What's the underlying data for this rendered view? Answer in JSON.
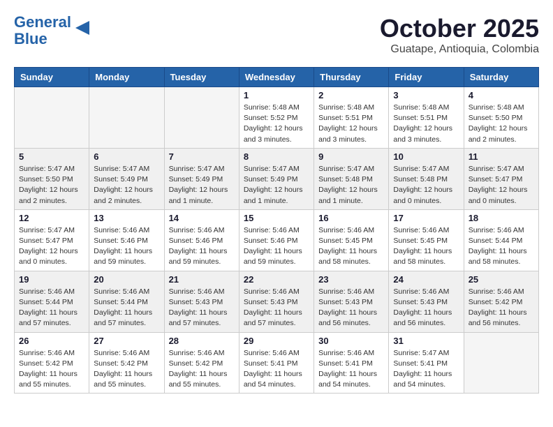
{
  "header": {
    "logo_line1": "General",
    "logo_line2": "Blue",
    "month": "October 2025",
    "location": "Guatape, Antioquia, Colombia"
  },
  "weekdays": [
    "Sunday",
    "Monday",
    "Tuesday",
    "Wednesday",
    "Thursday",
    "Friday",
    "Saturday"
  ],
  "weeks": [
    [
      {
        "day": "",
        "info": ""
      },
      {
        "day": "",
        "info": ""
      },
      {
        "day": "",
        "info": ""
      },
      {
        "day": "1",
        "info": "Sunrise: 5:48 AM\nSunset: 5:52 PM\nDaylight: 12 hours\nand 3 minutes."
      },
      {
        "day": "2",
        "info": "Sunrise: 5:48 AM\nSunset: 5:51 PM\nDaylight: 12 hours\nand 3 minutes."
      },
      {
        "day": "3",
        "info": "Sunrise: 5:48 AM\nSunset: 5:51 PM\nDaylight: 12 hours\nand 3 minutes."
      },
      {
        "day": "4",
        "info": "Sunrise: 5:48 AM\nSunset: 5:50 PM\nDaylight: 12 hours\nand 2 minutes."
      }
    ],
    [
      {
        "day": "5",
        "info": "Sunrise: 5:47 AM\nSunset: 5:50 PM\nDaylight: 12 hours\nand 2 minutes."
      },
      {
        "day": "6",
        "info": "Sunrise: 5:47 AM\nSunset: 5:49 PM\nDaylight: 12 hours\nand 2 minutes."
      },
      {
        "day": "7",
        "info": "Sunrise: 5:47 AM\nSunset: 5:49 PM\nDaylight: 12 hours\nand 1 minute."
      },
      {
        "day": "8",
        "info": "Sunrise: 5:47 AM\nSunset: 5:49 PM\nDaylight: 12 hours\nand 1 minute."
      },
      {
        "day": "9",
        "info": "Sunrise: 5:47 AM\nSunset: 5:48 PM\nDaylight: 12 hours\nand 1 minute."
      },
      {
        "day": "10",
        "info": "Sunrise: 5:47 AM\nSunset: 5:48 PM\nDaylight: 12 hours\nand 0 minutes."
      },
      {
        "day": "11",
        "info": "Sunrise: 5:47 AM\nSunset: 5:47 PM\nDaylight: 12 hours\nand 0 minutes."
      }
    ],
    [
      {
        "day": "12",
        "info": "Sunrise: 5:47 AM\nSunset: 5:47 PM\nDaylight: 12 hours\nand 0 minutes."
      },
      {
        "day": "13",
        "info": "Sunrise: 5:46 AM\nSunset: 5:46 PM\nDaylight: 11 hours\nand 59 minutes."
      },
      {
        "day": "14",
        "info": "Sunrise: 5:46 AM\nSunset: 5:46 PM\nDaylight: 11 hours\nand 59 minutes."
      },
      {
        "day": "15",
        "info": "Sunrise: 5:46 AM\nSunset: 5:46 PM\nDaylight: 11 hours\nand 59 minutes."
      },
      {
        "day": "16",
        "info": "Sunrise: 5:46 AM\nSunset: 5:45 PM\nDaylight: 11 hours\nand 58 minutes."
      },
      {
        "day": "17",
        "info": "Sunrise: 5:46 AM\nSunset: 5:45 PM\nDaylight: 11 hours\nand 58 minutes."
      },
      {
        "day": "18",
        "info": "Sunrise: 5:46 AM\nSunset: 5:44 PM\nDaylight: 11 hours\nand 58 minutes."
      }
    ],
    [
      {
        "day": "19",
        "info": "Sunrise: 5:46 AM\nSunset: 5:44 PM\nDaylight: 11 hours\nand 57 minutes."
      },
      {
        "day": "20",
        "info": "Sunrise: 5:46 AM\nSunset: 5:44 PM\nDaylight: 11 hours\nand 57 minutes."
      },
      {
        "day": "21",
        "info": "Sunrise: 5:46 AM\nSunset: 5:43 PM\nDaylight: 11 hours\nand 57 minutes."
      },
      {
        "day": "22",
        "info": "Sunrise: 5:46 AM\nSunset: 5:43 PM\nDaylight: 11 hours\nand 57 minutes."
      },
      {
        "day": "23",
        "info": "Sunrise: 5:46 AM\nSunset: 5:43 PM\nDaylight: 11 hours\nand 56 minutes."
      },
      {
        "day": "24",
        "info": "Sunrise: 5:46 AM\nSunset: 5:43 PM\nDaylight: 11 hours\nand 56 minutes."
      },
      {
        "day": "25",
        "info": "Sunrise: 5:46 AM\nSunset: 5:42 PM\nDaylight: 11 hours\nand 56 minutes."
      }
    ],
    [
      {
        "day": "26",
        "info": "Sunrise: 5:46 AM\nSunset: 5:42 PM\nDaylight: 11 hours\nand 55 minutes."
      },
      {
        "day": "27",
        "info": "Sunrise: 5:46 AM\nSunset: 5:42 PM\nDaylight: 11 hours\nand 55 minutes."
      },
      {
        "day": "28",
        "info": "Sunrise: 5:46 AM\nSunset: 5:42 PM\nDaylight: 11 hours\nand 55 minutes."
      },
      {
        "day": "29",
        "info": "Sunrise: 5:46 AM\nSunset: 5:41 PM\nDaylight: 11 hours\nand 54 minutes."
      },
      {
        "day": "30",
        "info": "Sunrise: 5:46 AM\nSunset: 5:41 PM\nDaylight: 11 hours\nand 54 minutes."
      },
      {
        "day": "31",
        "info": "Sunrise: 5:47 AM\nSunset: 5:41 PM\nDaylight: 11 hours\nand 54 minutes."
      },
      {
        "day": "",
        "info": ""
      }
    ]
  ]
}
